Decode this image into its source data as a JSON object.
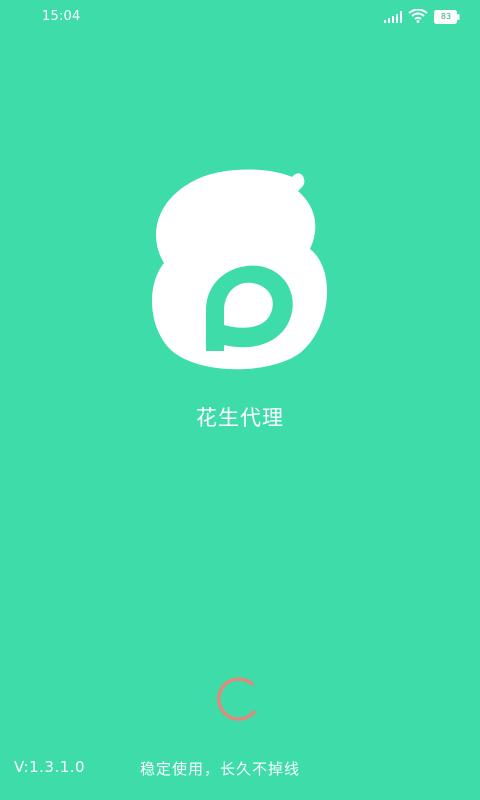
{
  "status_bar": {
    "time": "15:04",
    "battery_level": "83",
    "icons": [
      "signal-icon",
      "wifi-icon",
      "battery-icon"
    ]
  },
  "app": {
    "title": "花生代理",
    "logo_icon": "peanut-p-logo",
    "version": "V:1.3.1.0",
    "slogan": "稳定使用，长久不掉线"
  },
  "colors": {
    "background": "#3edca8",
    "text": "#ffffff",
    "spinner": "#e2897b"
  }
}
